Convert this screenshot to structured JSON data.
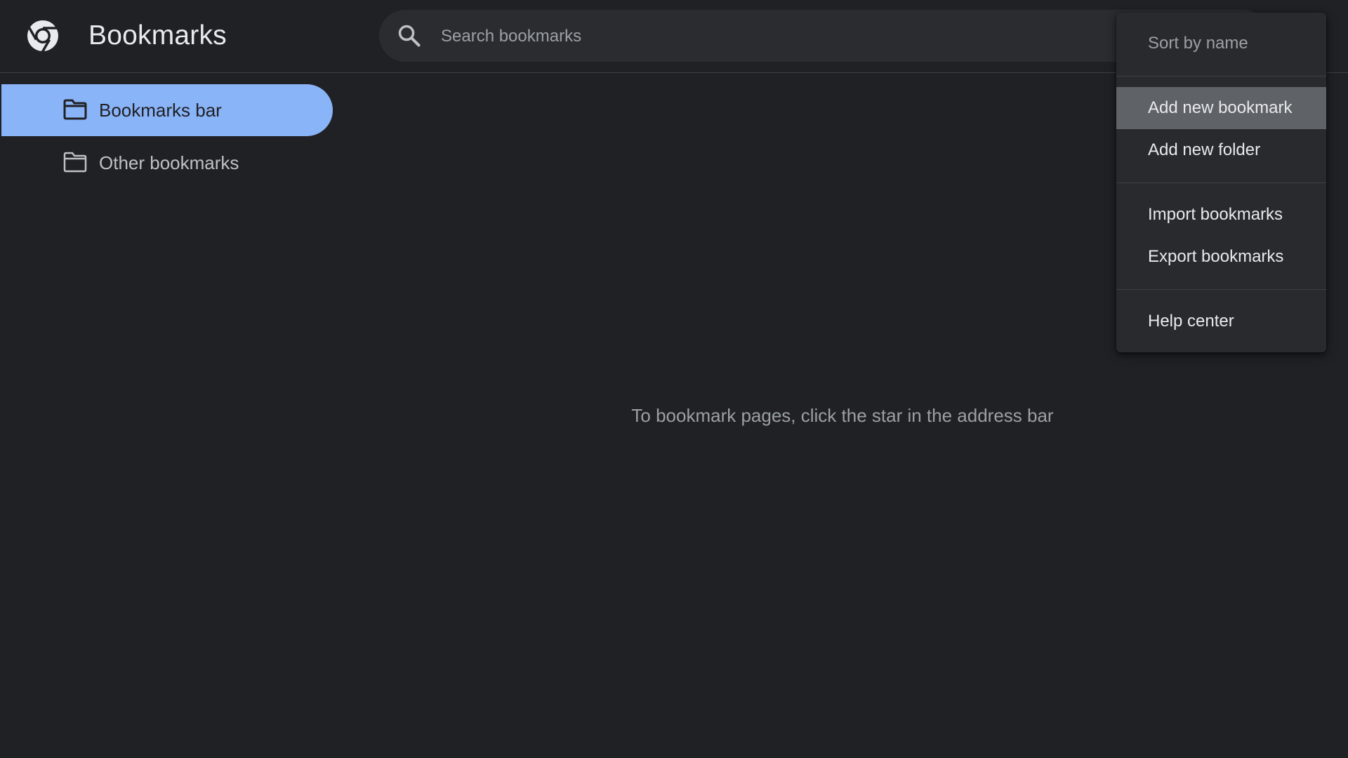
{
  "header": {
    "title": "Bookmarks",
    "logo_icon": "chrome-logo-icon",
    "search": {
      "placeholder": "Search bookmarks",
      "value": "",
      "icon": "search-icon"
    }
  },
  "sidebar": {
    "items": [
      {
        "label": "Bookmarks bar",
        "icon": "folder-icon",
        "selected": true
      },
      {
        "label": "Other bookmarks",
        "icon": "folder-icon",
        "selected": false
      }
    ]
  },
  "main": {
    "empty_message": "To bookmark pages, click the star in the address bar"
  },
  "menu": {
    "items": [
      {
        "label": "Sort by name",
        "state": "disabled"
      },
      {
        "label": "Add new bookmark",
        "state": "highlighted"
      },
      {
        "label": "Add new folder",
        "state": "normal"
      },
      {
        "label": "Import bookmarks",
        "state": "normal"
      },
      {
        "label": "Export bookmarks",
        "state": "normal"
      },
      {
        "label": "Help center",
        "state": "normal"
      }
    ]
  },
  "colors": {
    "background": "#202124",
    "accent": "#8ab4f8",
    "menu_background": "#292a2d",
    "menu_highlight": "#5f6368",
    "search_background": "#2b2c30"
  }
}
